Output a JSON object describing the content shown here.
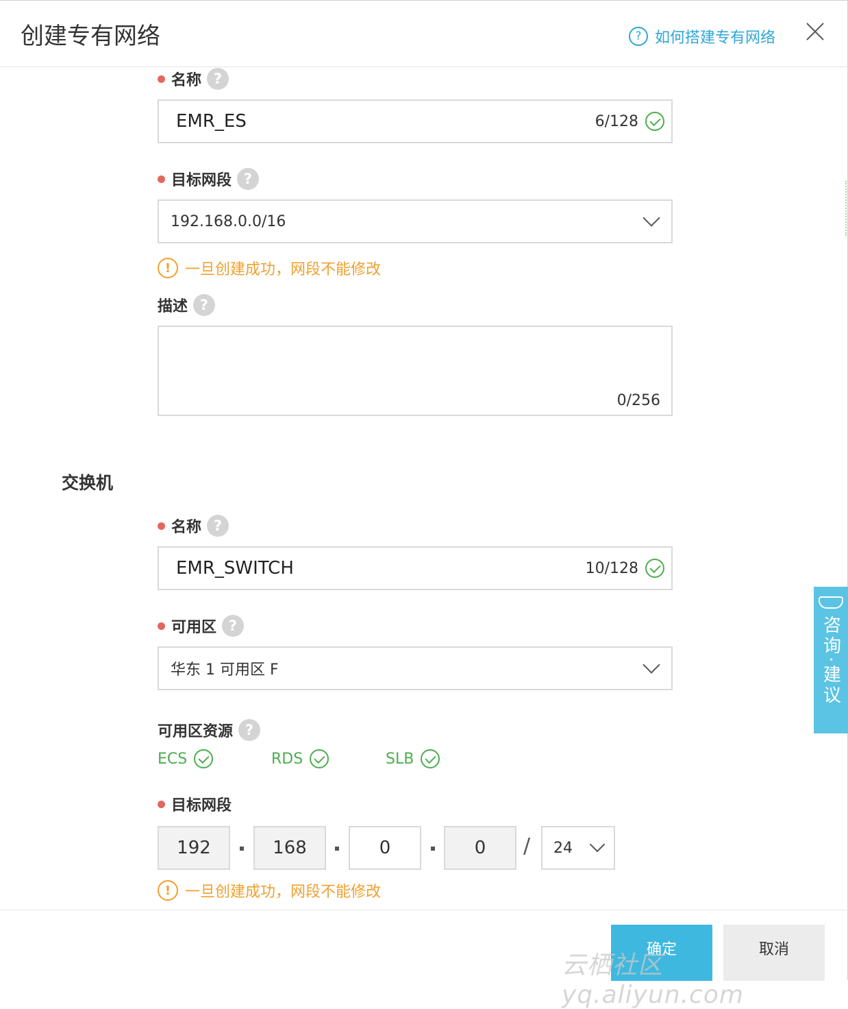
{
  "dialog": {
    "title": "创建专有网络",
    "help_link": "如何搭建专有网络",
    "help_icon_glyph": "?"
  },
  "vpc": {
    "name_label": "名称",
    "name_value": "EMR_ES",
    "name_count": "6/128",
    "cidr_label": "目标网段",
    "cidr_value": "192.168.0.0/16",
    "cidr_warning": "一旦创建成功，网段不能修改",
    "desc_label": "描述",
    "desc_value": "",
    "desc_count": "0/256"
  },
  "vswitch": {
    "section_title": "交换机",
    "name_label": "名称",
    "name_value": "EMR_SWITCH",
    "name_count": "10/128",
    "zone_label": "可用区",
    "zone_value": "华东 1 可用区 F",
    "resources_label": "可用区资源",
    "resources": [
      "ECS",
      "RDS",
      "SLB"
    ],
    "cidr_label": "目标网段",
    "cidr_segments": [
      "192",
      "168",
      "0",
      "0"
    ],
    "cidr_mask": "24",
    "cidr_slash": "/",
    "cidr_warning": "一旦创建成功，网段不能修改"
  },
  "buttons": {
    "ok": "确定",
    "cancel": "取消"
  },
  "side_tab": {
    "text": "咨询·建议"
  },
  "watermark": "云栖社区 yq.aliyun.com",
  "colors": {
    "accent": "#3fb8df",
    "link": "#2fa6d9",
    "required": "#e2685e",
    "success": "#4cae4c",
    "warning": "#f0a02c"
  },
  "icons": {
    "help": "question-circle-icon",
    "close": "close-icon",
    "valid": "check-circle-icon",
    "warning": "exclamation-circle-icon",
    "dropdown": "chevron-down-icon",
    "feedback": "chat-icon"
  }
}
